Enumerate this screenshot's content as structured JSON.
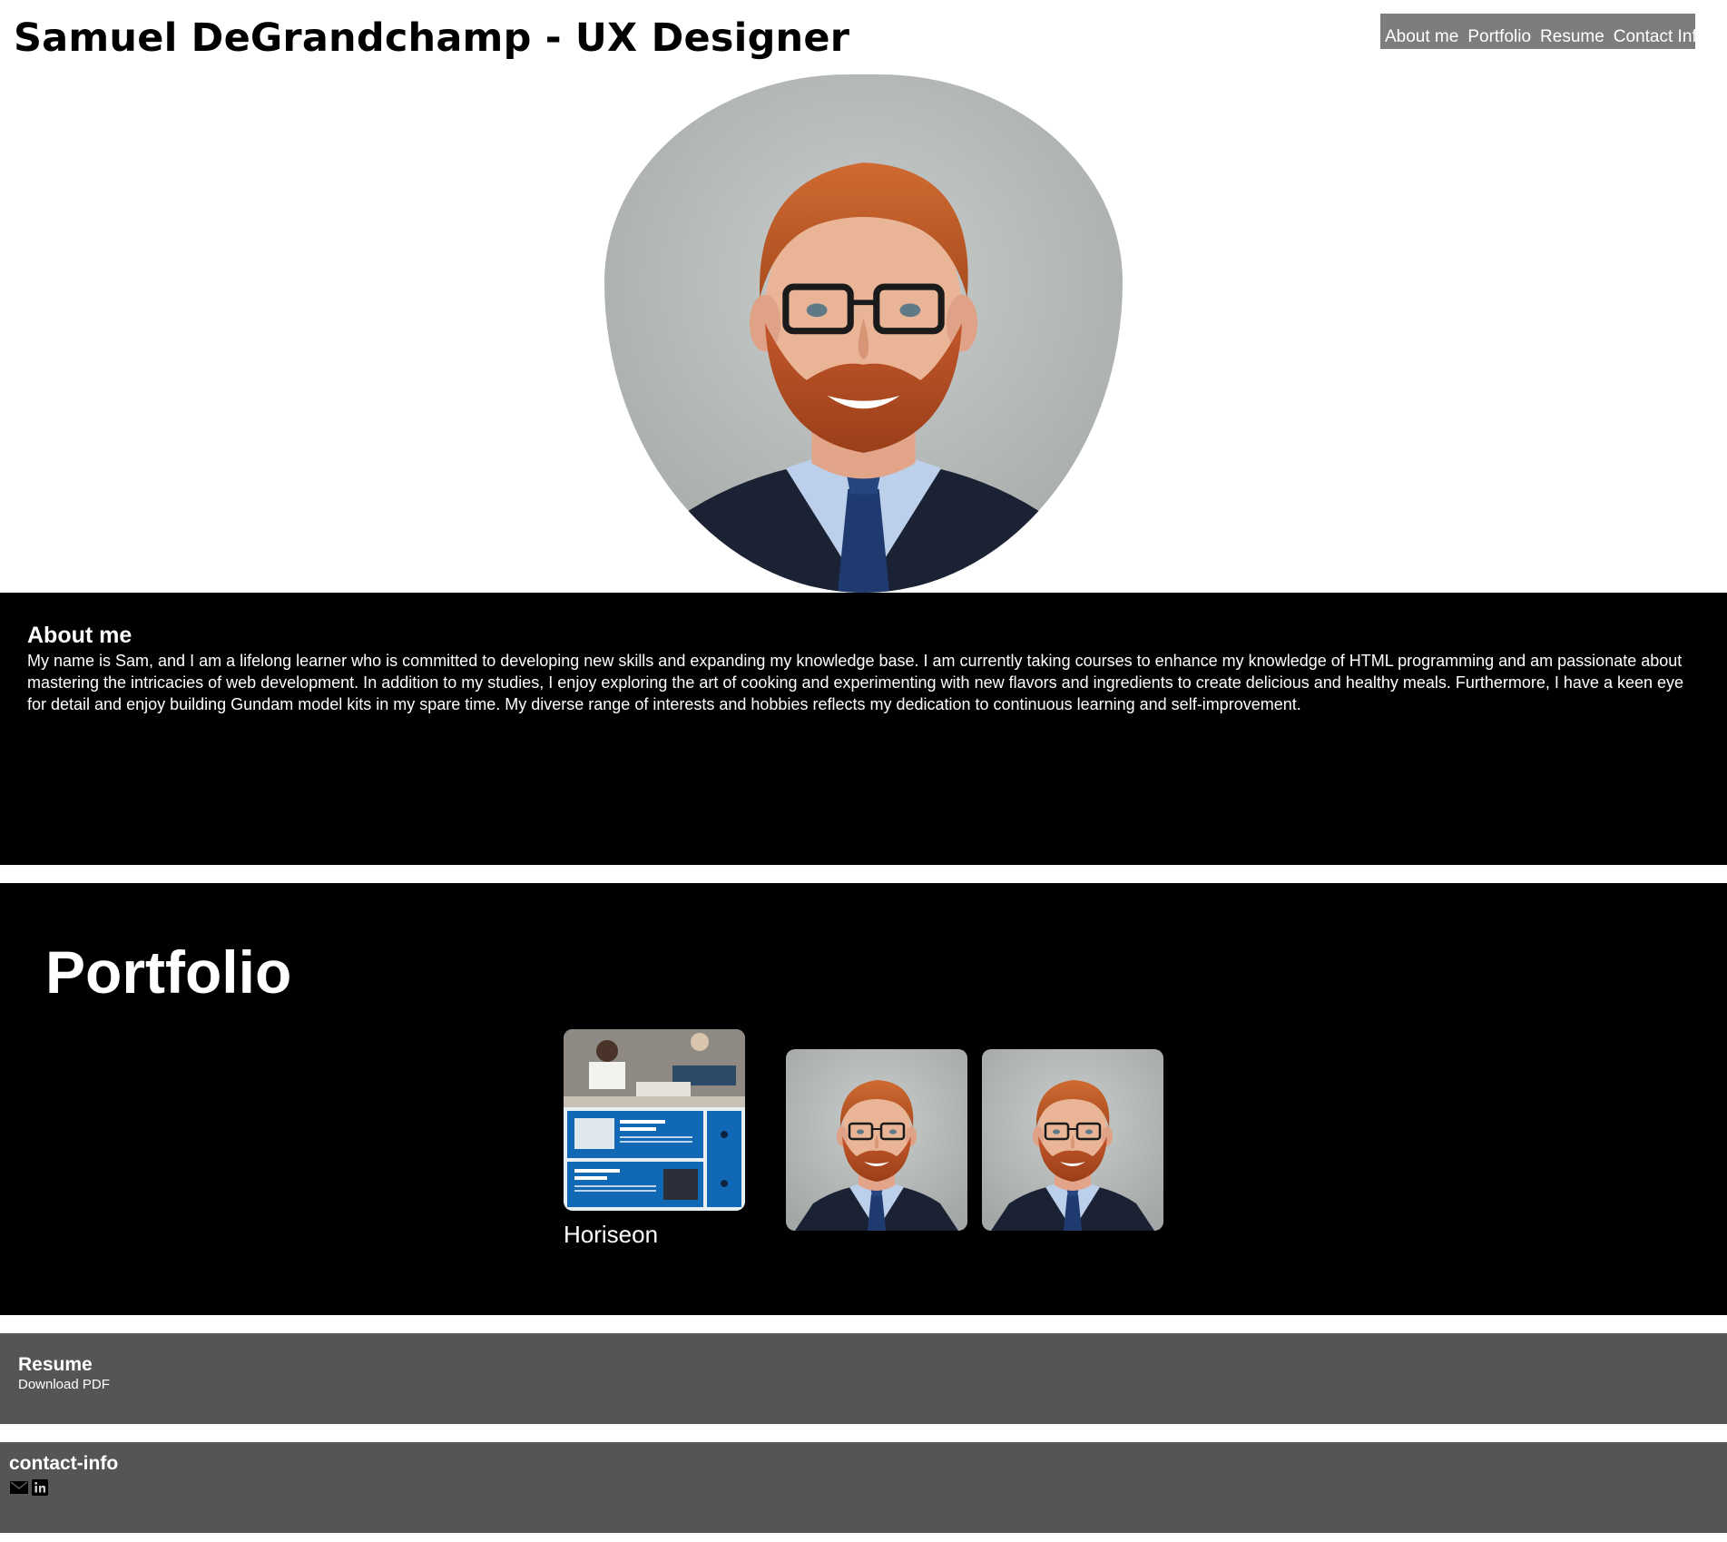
{
  "header": {
    "title": "Samuel DeGrandchamp - UX Designer",
    "nav": [
      {
        "label": "About me"
      },
      {
        "label": "Portfolio"
      },
      {
        "label": "Resume"
      },
      {
        "label": "Contact Info"
      }
    ]
  },
  "hero": {
    "photo_icon": "portrait-photo"
  },
  "about": {
    "heading": "About me",
    "body": "My name is Sam, and I am a lifelong learner who is committed to developing new skills and expanding my knowledge base. I am currently taking courses to enhance my knowledge of HTML programming and am passionate about mastering the intricacies of web development. In addition to my studies, I enjoy exploring the art of cooking and experimenting with new flavors and ingredients to create delicious and healthy meals. Furthermore, I have a keen eye for detail and enjoy building Gundam model kits in my spare time. My diverse range of interests and hobbies reflects my dedication to continuous learning and self-improvement."
  },
  "portfolio": {
    "heading": "Portfolio",
    "items": [
      {
        "label": "Horiseon"
      },
      {
        "label": ""
      },
      {
        "label": ""
      }
    ]
  },
  "resume": {
    "heading": "Resume",
    "link_label": "Download PDF"
  },
  "contact": {
    "heading": "contact-info",
    "icons": [
      "email-icon",
      "linkedin-icon"
    ]
  },
  "colors": {
    "nav_bg": "#7d7d7d",
    "section_dark": "#000000",
    "section_grey": "#555555",
    "text_light": "#ffffff"
  }
}
